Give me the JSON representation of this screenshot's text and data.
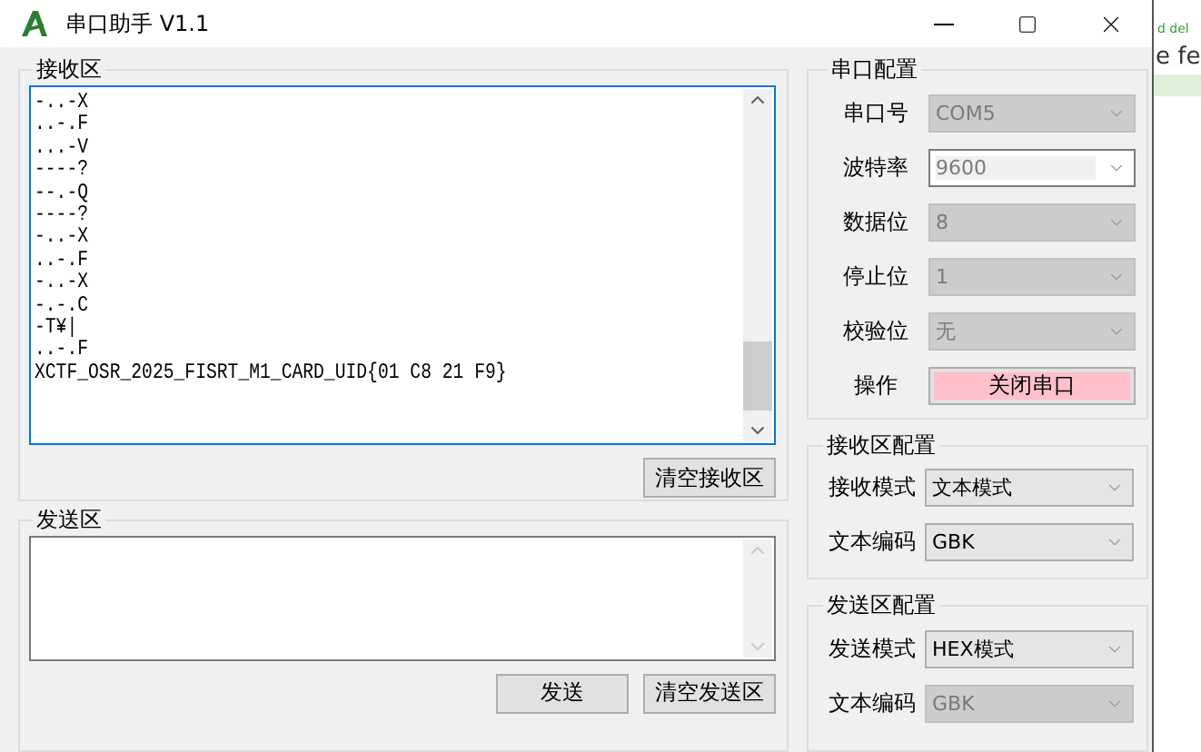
{
  "window": {
    "title": "串口助手 V1.1"
  },
  "receive_area": {
    "title": "接收区",
    "lines": [
      "-..-X",
      "..-.F",
      "...-V",
      "----?",
      "--.-Q",
      "----?",
      "-..-X",
      "..-.F",
      "-..-X",
      "-.-.C",
      "-T¥|",
      "..-.F",
      "XCTF_OSR_2025_FISRT_M1_CARD_UID{01 C8 21 F9}"
    ],
    "clear_button": "清空接收区"
  },
  "send_area": {
    "title": "发送区",
    "send_button": "发送",
    "clear_button": "清空发送区"
  },
  "serial_config": {
    "title": "串口配置",
    "fields": [
      {
        "label": "串口号",
        "value": "COM5",
        "kind": "dropdown",
        "disabled": true
      },
      {
        "label": "波特率",
        "value": "9600",
        "kind": "editable",
        "disabled": false
      },
      {
        "label": "数据位",
        "value": "8",
        "kind": "dropdown",
        "disabled": true
      },
      {
        "label": "停止位",
        "value": "1",
        "kind": "dropdown",
        "disabled": true
      },
      {
        "label": "校验位",
        "value": "无",
        "kind": "dropdown",
        "disabled": true
      }
    ],
    "action_label": "操作",
    "action_button": "关闭串口"
  },
  "receive_config": {
    "title": "接收区配置",
    "fields": [
      {
        "label": "接收模式",
        "value": "文本模式",
        "kind": "dropdown",
        "disabled": false
      },
      {
        "label": "文本编码",
        "value": "GBK",
        "kind": "dropdown",
        "disabled": false
      }
    ]
  },
  "send_config": {
    "title": "发送区配置",
    "fields": [
      {
        "label": "发送模式",
        "value": "HEX模式",
        "kind": "dropdown",
        "disabled": false
      },
      {
        "label": "文本编码",
        "value": "GBK",
        "kind": "dropdown",
        "disabled": true
      }
    ]
  },
  "background_window": {
    "texts": [
      "d del",
      "e fe"
    ]
  }
}
